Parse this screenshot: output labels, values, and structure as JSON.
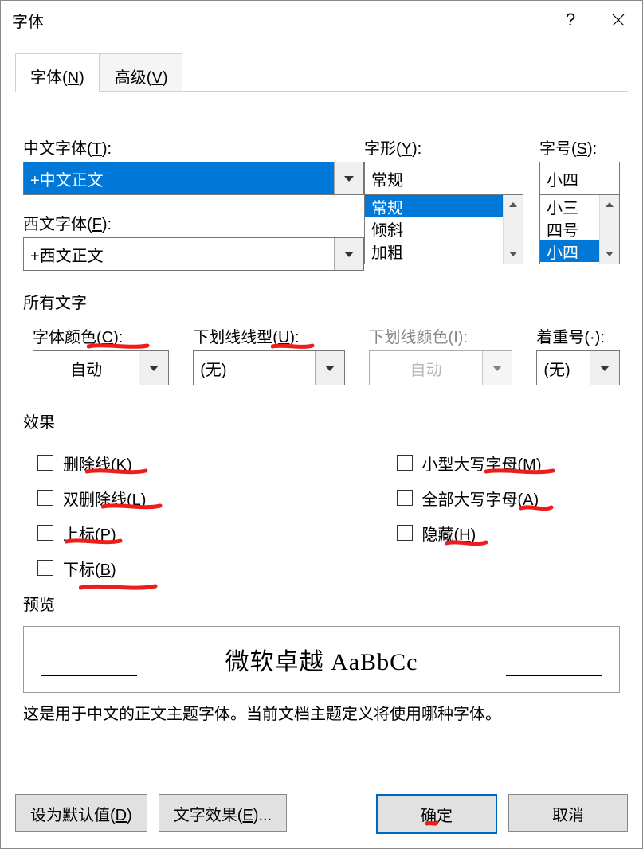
{
  "window": {
    "title": "字体"
  },
  "tabs": {
    "font": {
      "pre": "字体(",
      "key": "N",
      "post": ")"
    },
    "advanced": {
      "pre": "高级(",
      "key": "V",
      "post": ")"
    }
  },
  "fields": {
    "cnFont": {
      "label_pre": "中文字体(",
      "key": "T",
      "label_post": "):",
      "value": "+中文正文"
    },
    "enFont": {
      "label_pre": "西文字体(",
      "key": "F",
      "label_post": "):",
      "value": "+西文正文"
    },
    "style": {
      "label_pre": "字形(",
      "key": "Y",
      "label_post": "):",
      "value": "常规",
      "options": [
        "常规",
        "倾斜",
        "加粗"
      ]
    },
    "size": {
      "label_pre": "字号(",
      "key": "S",
      "label_post": "):",
      "value": "小四",
      "options": [
        "小三",
        "四号",
        "小四"
      ]
    }
  },
  "allText": {
    "label": "所有文字"
  },
  "group2": {
    "color": {
      "label_pre": "字体颜色(",
      "key": "C",
      "label_post": "):",
      "value": "自动"
    },
    "underline": {
      "label_pre": "下划线线型(",
      "key": "U",
      "label_post": "):",
      "value": "(无)"
    },
    "ulColor": {
      "label": "下划线颜色(I):",
      "value": "自动"
    },
    "emphasis": {
      "label": "着重号(·):",
      "value": "(无)"
    }
  },
  "effects": {
    "label": "效果",
    "left": [
      {
        "pre": "删除线(",
        "key": "K",
        "post": ")"
      },
      {
        "pre": "双删除线(",
        "key": "L",
        "post": ")"
      },
      {
        "pre": "上标(",
        "key": "P",
        "post": ")"
      },
      {
        "pre": "下标(",
        "key": "B",
        "post": ")"
      }
    ],
    "right": [
      {
        "pre": "小型大写字母(",
        "key": "M",
        "post": ")"
      },
      {
        "pre": "全部大写字母(",
        "key": "A",
        "post": ")"
      },
      {
        "pre": "隐藏(",
        "key": "H",
        "post": ")"
      }
    ]
  },
  "preview": {
    "label": "预览",
    "sample": "微软卓越  AaBbCc"
  },
  "note": "这是用于中文的正文主题字体。当前文档主题定义将使用哪种字体。",
  "footer": {
    "default": {
      "pre": "设为默认值(",
      "key": "D",
      "post": ")"
    },
    "textEffect": {
      "pre": "文字效果(",
      "key": "E",
      "post": ")..."
    },
    "ok": "确定",
    "cancel": "取消"
  }
}
